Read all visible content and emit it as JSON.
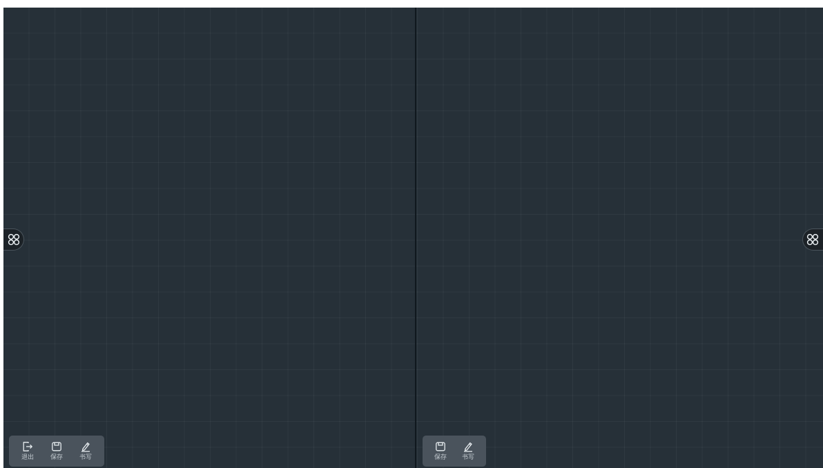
{
  "icons": {
    "side_menu": "apps-grid-icon",
    "exit": "exit-icon",
    "save": "save-icon",
    "write": "pen-icon"
  },
  "colors": {
    "canvas_background": "#263038",
    "grid_line": "rgba(255,255,255,0.045)",
    "toolbar_background": "#4a535c",
    "divider": "#10181e",
    "icon_color": "#e8edf0"
  },
  "left_panel": {
    "toolbar": {
      "exit_label": "退出",
      "save_label": "保存",
      "write_label": "书写"
    }
  },
  "right_panel": {
    "toolbar": {
      "save_label": "保存",
      "write_label": "书写"
    }
  }
}
